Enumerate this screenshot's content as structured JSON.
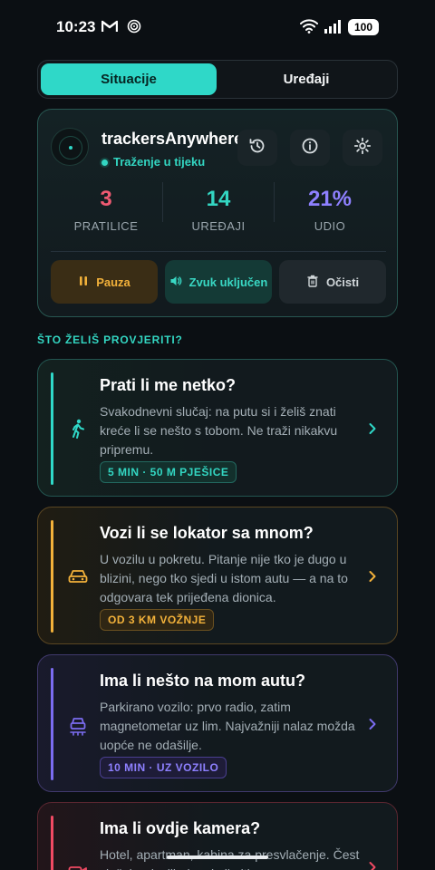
{
  "status_bar": {
    "time": "10:23",
    "battery": "100"
  },
  "tabs": [
    {
      "label": "Situacije",
      "active": true
    },
    {
      "label": "Uređaji",
      "active": false
    }
  ],
  "tracker": {
    "name": "trackersAnywhere",
    "status": "Traženje u tijeku",
    "stats": [
      {
        "value": "3",
        "label": "PRATILICE",
        "color": "#f05a72"
      },
      {
        "value": "14",
        "label": "UREĐAJI",
        "color": "#33d6c2"
      },
      {
        "value": "21%",
        "label": "UDIO",
        "color": "#8e80ff"
      }
    ],
    "actions": {
      "pause": "Pauza",
      "sound": "Zvuk uključen",
      "clear": "Očisti"
    }
  },
  "section_title": "ŠTO ŽELIŠ PROVJERITI?",
  "scenarios": [
    {
      "title": "Prati li me netko?",
      "description": "Svakodnevni slučaj: na putu si i želiš znati kreće li se nešto s tobom. Ne traži nikakvu pripremu.",
      "tag": "5 MIN · 50 M PJEŠICE",
      "icon": "walking-person-icon",
      "accent": "#2fd8c8"
    },
    {
      "title": "Vozi li se lokator sa mnom?",
      "description": "U vozilu u pokretu. Pitanje nije tko je dugo u blizini, nego tko sjedi u istom autu — a na to odgovara tek prijeđena dionica.",
      "tag": "OD 3 KM VOŽNJE",
      "icon": "car-icon",
      "accent": "#f2b13a"
    },
    {
      "title": "Ima li nešto na mom autu?",
      "description": "Parkirano vozilo: prvo radio, zatim magnetometar uz lim. Najvažniji nalaz možda uopće ne odašilje.",
      "tag": "10 MIN · UZ VOZILO",
      "icon": "parked-car-icon",
      "accent": "#7b6cf0"
    },
    {
      "title": "Ima li ovdje kamera?",
      "description": "Hotel, apartman, kabina za presvlačenje. Čest slučaj redoslijedom koji nitko sam ne",
      "icon": "camera-icon",
      "accent": "#f04a63"
    }
  ]
}
